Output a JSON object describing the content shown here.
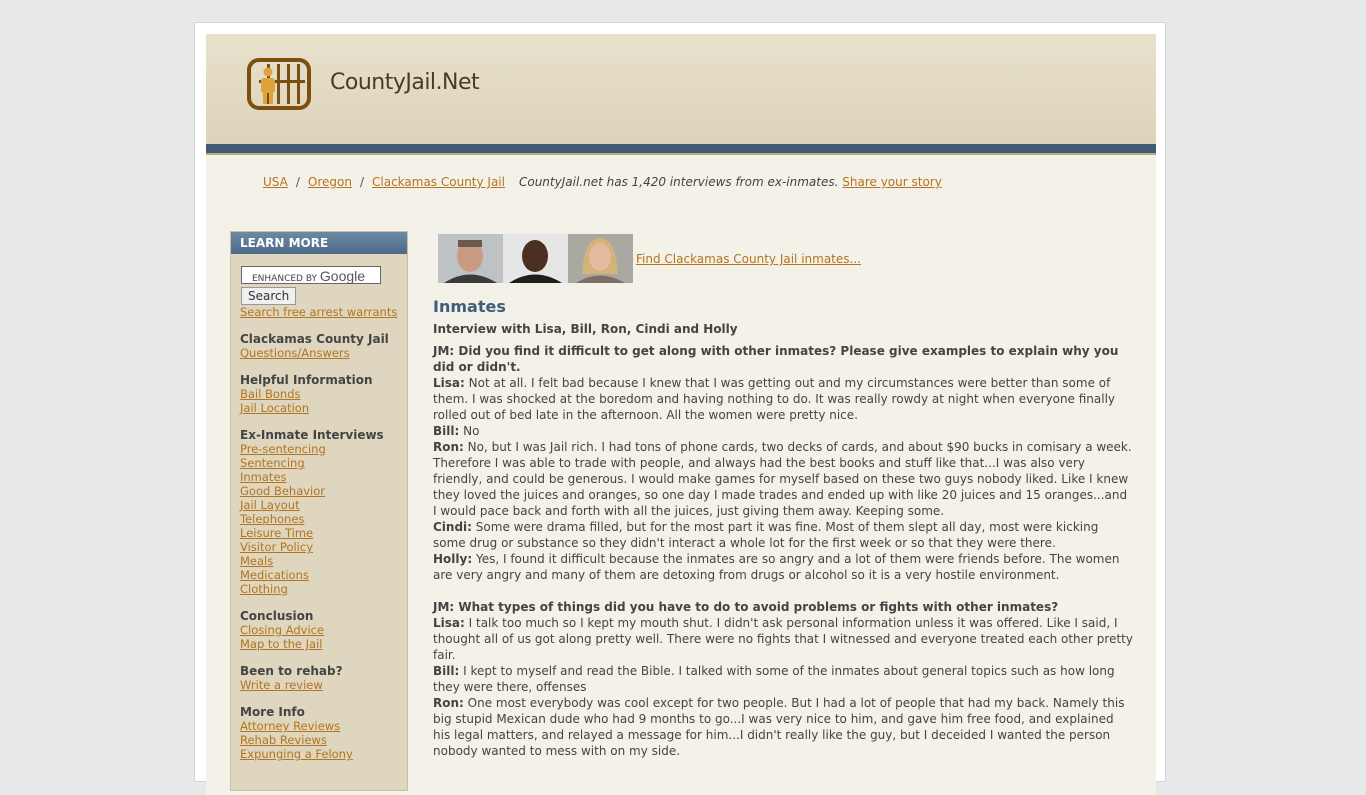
{
  "site": {
    "title": "CountyJail.Net"
  },
  "breadcrumb": {
    "items": [
      "USA",
      "Oregon",
      "Clackamas County Jail"
    ],
    "note": "CountyJail.net has 1,420 interviews from ex-inmates.",
    "share": "Share your story"
  },
  "sidebar": {
    "header": "LEARN MORE",
    "search_placeholder": "ENHANCED BY",
    "search_brand": "Google",
    "search_button": "Search",
    "warrants_link": "Search free arrest warrants",
    "groups": [
      {
        "title": "Clackamas County Jail",
        "links": [
          "Questions/Answers"
        ]
      },
      {
        "title": "Helpful Information",
        "links": [
          "Bail Bonds",
          "Jail Location"
        ]
      },
      {
        "title": "Ex-Inmate Interviews",
        "links": [
          "Pre-sentencing",
          "Sentencing",
          "Inmates",
          "Good Behavior",
          "Jail Layout",
          "Telephones",
          "Leisure Time",
          "Visitor Policy",
          "Meals",
          "Medications",
          "Clothing"
        ]
      },
      {
        "title": "Conclusion",
        "links": [
          "Closing Advice",
          "Map to the Jail"
        ]
      },
      {
        "title": "Been to rehab?",
        "links": [
          "Write a review"
        ]
      },
      {
        "title": "More Info",
        "links": [
          "Attorney Reviews",
          "Rehab Reviews",
          "Expunging a Felony"
        ]
      }
    ]
  },
  "main": {
    "find_link": "Find Clackamas County Jail inmates...",
    "heading": "Inmates",
    "subheading": "Interview with Lisa, Bill, Ron, Cindi and Holly",
    "q1": "JM: Did you find it difficult to get along with other inmates? Please give examples to explain why you did or didn't.",
    "a1": [
      {
        "name": "Lisa:",
        "text": "Not at all. I felt bad because I knew that I was getting out and my circumstances were better than some of them. I was shocked at the boredom and having nothing to do. It was really rowdy at night when everyone finally rolled out of bed late in the afternoon. All the women were pretty nice."
      },
      {
        "name": "Bill:",
        "text": "No"
      },
      {
        "name": "Ron:",
        "text": "No, but I was Jail rich. I had tons of phone cards, two decks of cards, and about $90 bucks in comisary a week. Therefore I was able to trade with people, and always had the best books and stuff like that...I was also very friendly, and could be generous. I would make games for myself based on these two guys nobody liked. Like I knew they loved the juices and oranges, so one day I made trades and ended up with like 20 juices and 15 oranges...and I would pace back and forth with all the juices, just giving them away. Keeping some."
      },
      {
        "name": "Cindi:",
        "text": "Some were drama filled, but for the most part it was fine. Most of them slept all day, most were kicking some drug or substance so they didn't interact a whole lot for the first week or so that they were there."
      },
      {
        "name": "Holly:",
        "text": "Yes, I found it difficult because the inmates are so angry and a lot of them were friends before. The women are very angry and many of them are detoxing from drugs or alcohol so it is a very hostile environment."
      }
    ],
    "q2": "JM: What types of things did you have to do to avoid problems or fights with other inmates?",
    "a2": [
      {
        "name": "Lisa:",
        "text": "I talk too much so I kept my mouth shut. I didn't ask personal information unless it was offered. Like I said, I thought all of us got along pretty well. There were no fights that I witnessed and everyone treated each other pretty fair."
      },
      {
        "name": "Bill:",
        "text": "I kept to myself and read the Bible. I talked with some of the inmates about general topics such as how long they were there, offenses"
      },
      {
        "name": "Ron:",
        "text": "One most everybody was cool except for two people. But I had a lot of people that had my back. Namely this big stupid Mexican dude who had 9 months to go...I was very nice to him, and gave him free food, and explained his legal matters, and relayed a message for him...I didn't really like the guy, but I deceided I wanted the person nobody wanted to mess with on my side."
      }
    ]
  }
}
